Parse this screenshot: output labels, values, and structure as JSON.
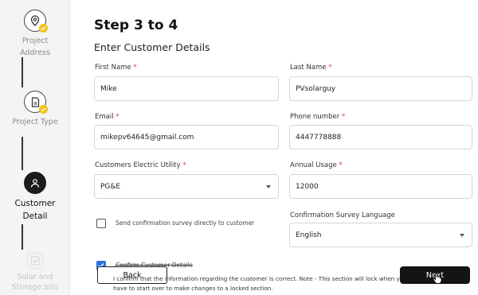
{
  "sidebar": {
    "steps": [
      {
        "label": "Project Address",
        "icon": "location-pin-icon",
        "state": "done"
      },
      {
        "label": "Project Type",
        "icon": "document-icon",
        "state": "done"
      },
      {
        "label": "Customer Detail",
        "icon": "person-icon",
        "state": "active"
      },
      {
        "label": "Solar and Storage Info",
        "icon": "chart-icon",
        "state": "pending"
      }
    ]
  },
  "header": {
    "title": "Step 3 to 4",
    "subtitle": "Enter Customer Details"
  },
  "form": {
    "first_name": {
      "label": "First Name",
      "required": "*",
      "value": "Mike"
    },
    "last_name": {
      "label": "Last Name",
      "required": "*",
      "value": "PVsolarguy"
    },
    "email": {
      "label": "Email",
      "required": "*",
      "value": "mikepv64645@gmail.com"
    },
    "phone": {
      "label": "Phone number",
      "required": "*",
      "value": "4447778888"
    },
    "utility": {
      "label": "Customers Electric Utility",
      "required": "*",
      "value": "PG&E"
    },
    "annual_usage": {
      "label": "Annual Usage",
      "required": "*",
      "value": "12000"
    },
    "send_survey": {
      "label": "Send confirmation survey directly to customer",
      "checked": false
    },
    "survey_language": {
      "label": "Confirmation Survey Language",
      "value": "English"
    },
    "confirm": {
      "label": "Confirm Customer Details",
      "checked": true,
      "note_line1": "I confirm that the information regarding the customer is correct. Note - This section will lock when you",
      "note_line2": "have to start over to make changes to a locked section."
    }
  },
  "actions": {
    "back_label": "Back",
    "next_label": "Next"
  },
  "colors": {
    "accent_check": "#f0c419",
    "checkbox_blue": "#2f6fdf",
    "required_red": "#e03b3b",
    "primary_button": "#141414"
  }
}
